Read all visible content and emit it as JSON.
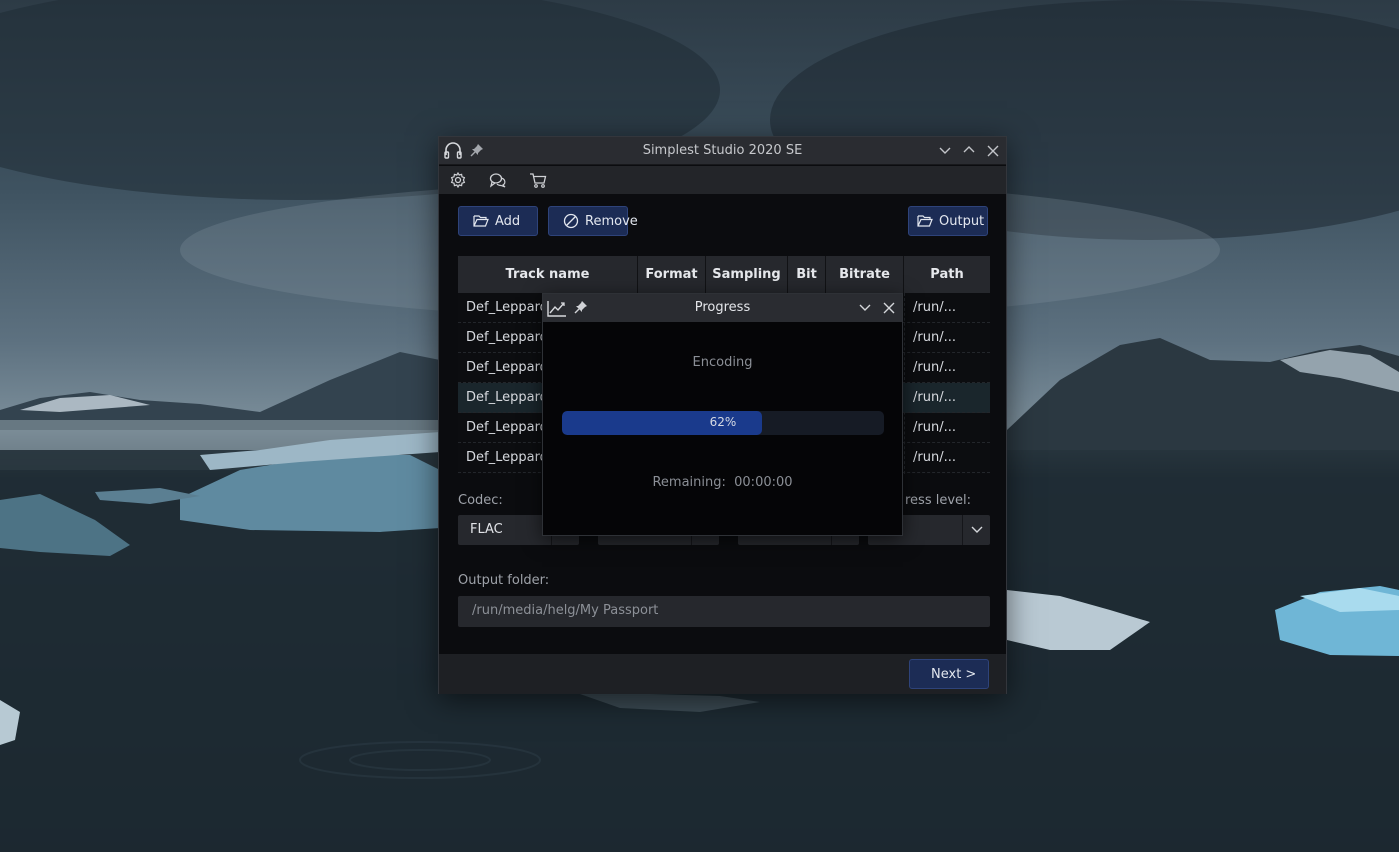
{
  "window": {
    "title": "Simplest Studio 2020 SE",
    "titlebar_icons": [
      "headphones-icon",
      "pin-icon"
    ],
    "window_controls": [
      "minimize-icon",
      "maximize-icon",
      "close-icon"
    ]
  },
  "toolbar": {
    "icons": [
      "gear-icon",
      "chat-icon",
      "cart-icon"
    ]
  },
  "actions": {
    "add_label": "Add",
    "remove_label": "Remove",
    "output_label": "Output"
  },
  "table": {
    "columns": [
      "Track name",
      "Format",
      "Sampling",
      "Bit",
      "Bitrate",
      "Path"
    ],
    "rows": [
      {
        "name": "Def_Leppard",
        "path": "/run/...",
        "selected": false
      },
      {
        "name": "Def_Leppard",
        "path": "/run/...",
        "selected": false
      },
      {
        "name": "Def_Leppard",
        "path": "/run/...",
        "selected": false
      },
      {
        "name": "Def_Leppard",
        "path": "/run/...",
        "selected": true
      },
      {
        "name": "Def_Leppard",
        "path": "/run/...",
        "selected": false
      },
      {
        "name": "Def_Leppard",
        "path": "/run/...",
        "selected": false
      }
    ]
  },
  "settings": {
    "codec_label": "Codec:",
    "codec_value": "FLAC",
    "compress_label_visible": "ress level:",
    "output_folder_label": "Output folder:",
    "output_folder_value": "/run/media/helg/My Passport"
  },
  "footer": {
    "next_label": "Next >"
  },
  "progress_dialog": {
    "title": "Progress",
    "status": "Encoding",
    "percent": 62,
    "percent_label": "62%",
    "remaining_label": "Remaining:",
    "remaining_value": "00:00:00"
  },
  "colors": {
    "accent_button": "#1c2c55",
    "progress_fill": "#1a3a8c",
    "window_bg": "#0b0c0f"
  }
}
